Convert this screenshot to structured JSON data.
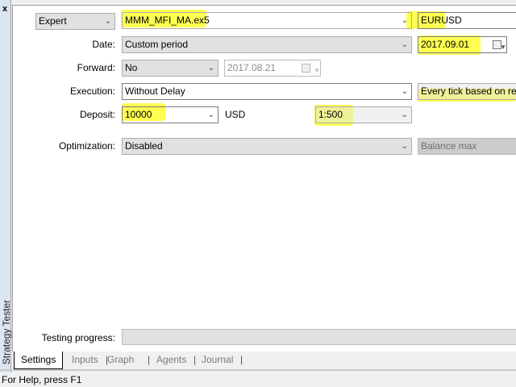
{
  "window": {
    "close_icon": "x",
    "side_title": "Strategy Tester"
  },
  "settings": {
    "type_select": "Expert",
    "expert": "MMM_MFI_MA.ex5",
    "symbol": "EURUSD",
    "date_label": "Date:",
    "date_mode": "Custom period",
    "date_to": "2017.09.01",
    "forward_label": "Forward:",
    "forward_value": "No",
    "forward_date": "2017.08.21",
    "execution_label": "Execution:",
    "execution_value": "Without Delay",
    "model_value": "Every tick based on real ticks",
    "deposit_label": "Deposit:",
    "deposit_value": "10000",
    "currency": "USD",
    "leverage": "1:500",
    "optimization_label": "Optimization:",
    "optimization_value": "Disabled",
    "criterion": "Balance max",
    "progress_label": "Testing progress:"
  },
  "tabs": [
    "Settings",
    "Inputs",
    "Graph",
    "Agents",
    "Journal"
  ],
  "status_text": "For Help, press F1",
  "colors": {
    "highlight": "#ffff33"
  }
}
